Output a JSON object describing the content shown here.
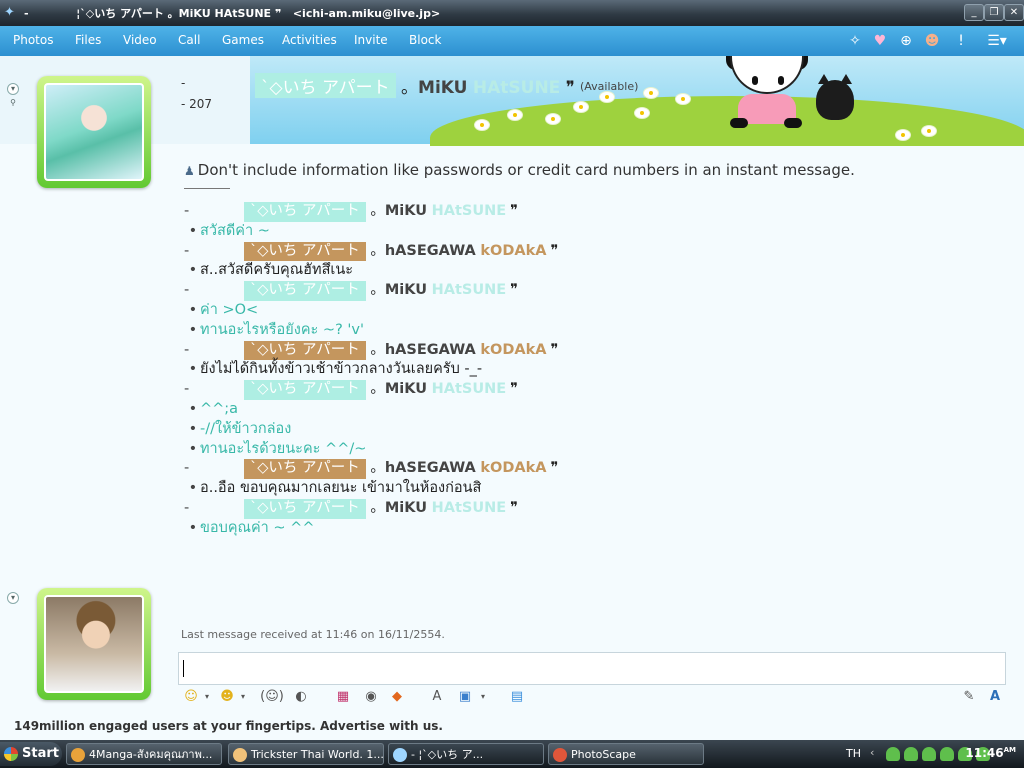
{
  "window": {
    "title_prefix": "-",
    "title_name": "¦`◇いち アパート 。MiKU HAtSUNE ❞",
    "title_email": "<ichi-am.miku@live.jp>",
    "buttons": {
      "minimize": "_",
      "maximize": "❐",
      "close": "✕"
    }
  },
  "menu": {
    "items": [
      "Photos",
      "Files",
      "Video",
      "Call",
      "Games",
      "Activities",
      "Invite",
      "Block"
    ]
  },
  "header": {
    "dash": "-",
    "count": "- 207",
    "contact": {
      "pill": "`◇いち アパート",
      "sep": "。",
      "first": "MiKU",
      "last": "HAtSUNE",
      "tail": "❞"
    },
    "status": "(Available)"
  },
  "conversation": {
    "warning": "Don't include information like passwords or credit card numbers in an instant message.",
    "miku_pill": "`◇いち アパート",
    "hase_pill": "`◇いち アパート",
    "miku_first": "MiKU",
    "miku_last": "HAtSUNE",
    "hase_first": "hASEGAWA",
    "hase_last": "kODAkA",
    "sep": "。",
    "quote": "❞",
    "lines": [
      {
        "type": "hdr-m"
      },
      {
        "type": "msg",
        "who": "m",
        "text": "สวัสดีค่า ~"
      },
      {
        "type": "hdr-h"
      },
      {
        "type": "msg",
        "who": "h",
        "text": "ส..สวัสดีครับคุณฮัทสึเนะ"
      },
      {
        "type": "hdr-m"
      },
      {
        "type": "msg",
        "who": "m",
        "text": "ค่า >O<"
      },
      {
        "type": "msg",
        "who": "m",
        "text": "ทานอะไรหรือยังคะ ~? 'v'"
      },
      {
        "type": "hdr-h"
      },
      {
        "type": "msg",
        "who": "h",
        "text": "ยังไม่ได้กินทั้งข้าวเช้าข้าวกลางวันเลยครับ -_-"
      },
      {
        "type": "hdr-m"
      },
      {
        "type": "msg",
        "who": "m",
        "text": "^^;a"
      },
      {
        "type": "msg",
        "who": "m",
        "text": "-//ให้ข้าวกล่อง"
      },
      {
        "type": "msg",
        "who": "m",
        "text": "ทานอะไรด้วยนะคะ ^^/~"
      },
      {
        "type": "hdr-h"
      },
      {
        "type": "msg",
        "who": "h",
        "text": "อ..อือ ขอบคุณมากเลยนะ เข้ามาในห้องก่อนสิ"
      },
      {
        "type": "hdr-m"
      },
      {
        "type": "msg",
        "who": "m",
        "text": "ขอบคุณค่า ~ ^^"
      }
    ],
    "last_message": "Last message received at 11:46 on 16/11/2554."
  },
  "ad": "149million engaged users at your fingertips. Advertise with us.",
  "taskbar": {
    "start": "Start",
    "tasks": [
      {
        "label": "4Manga-สังคมคุณภาพ...",
        "color": "#e8a23a"
      },
      {
        "label": "Trickster Thai World. 1...",
        "color": "#f1c27a"
      },
      {
        "label": "-       ¦`◇いち ア...",
        "color": "#9fd6ff"
      },
      {
        "label": "PhotoScape",
        "color": "#e0563a"
      }
    ],
    "lang": "TH",
    "time": "11:46",
    "ampm": "AM"
  },
  "colors": {
    "accent": "#2c8fd0",
    "miku_pill": "#aeeee3",
    "hase_pill": "#c4965e",
    "green_text": "#38b8a8"
  }
}
